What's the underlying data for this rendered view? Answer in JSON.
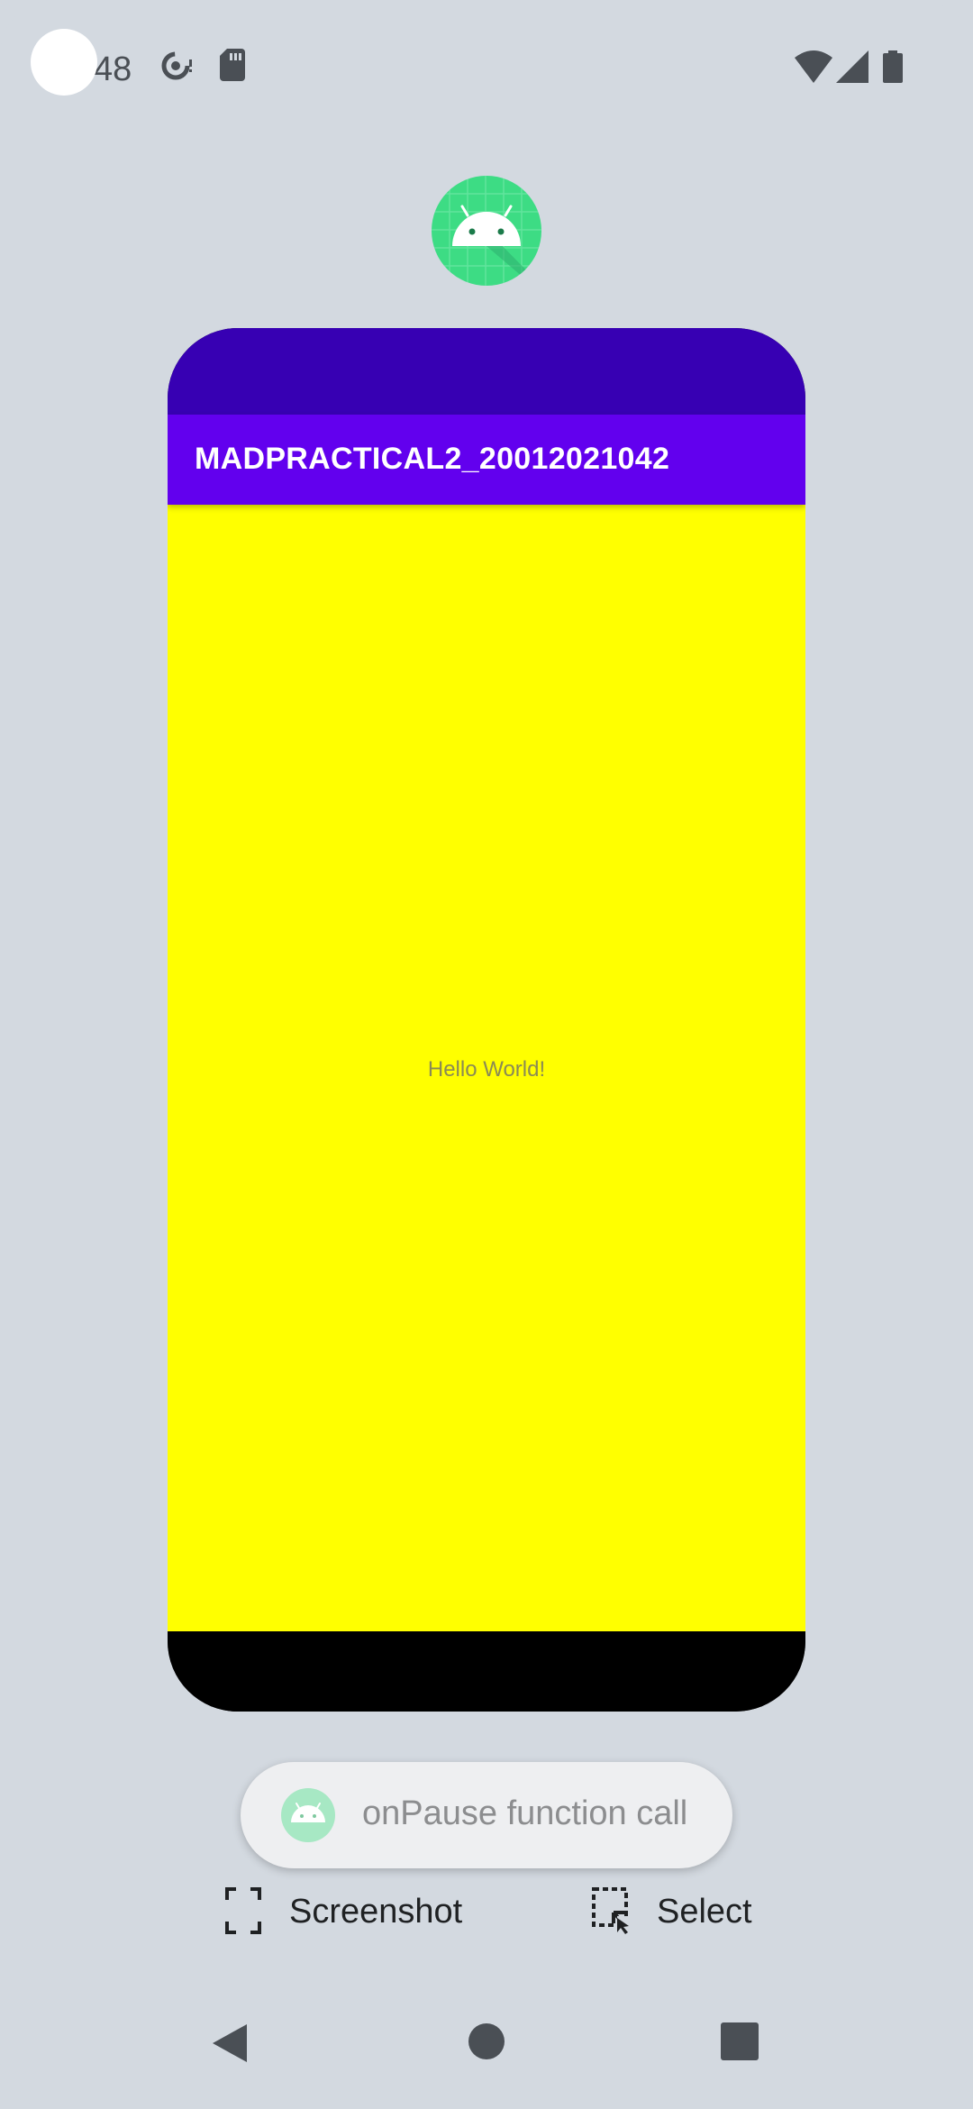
{
  "status_bar": {
    "time": "48",
    "icons": [
      "screen-record-icon",
      "sd-card-icon",
      "wifi-icon",
      "cell-signal-icon",
      "battery-icon"
    ]
  },
  "app": {
    "icon": "android-app-icon",
    "title": "MADPRACTICAL2_20012021042",
    "content_text": "Hello World!",
    "colors": {
      "status": "#3700b3",
      "toolbar": "#6200ee",
      "background": "#ffff00"
    }
  },
  "toast": {
    "message": "onPause function call",
    "icon": "android-app-icon"
  },
  "actions": {
    "screenshot_label": "Screenshot",
    "select_label": "Select"
  },
  "nav": {
    "back": "back-icon",
    "home": "home-icon",
    "recents": "recents-icon"
  }
}
